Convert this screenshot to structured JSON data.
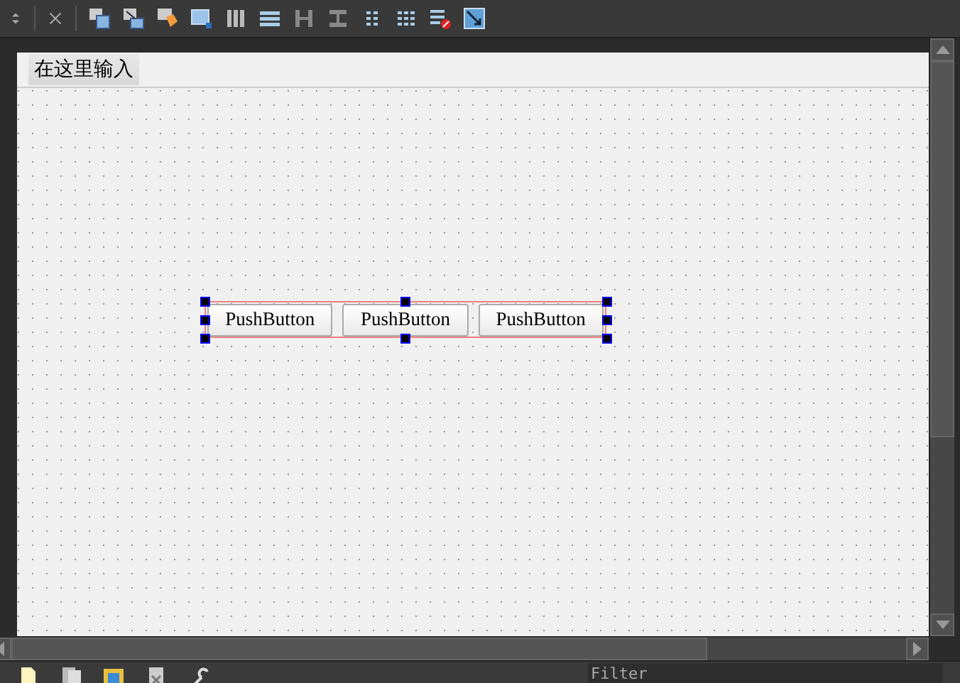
{
  "menu_bar": {
    "items": [
      {
        "label": "在这里输入",
        "selected": true
      }
    ]
  },
  "layout": {
    "selected": true,
    "buttons": [
      {
        "label": "PushButton"
      },
      {
        "label": "PushButton"
      },
      {
        "label": "PushButton"
      }
    ]
  },
  "filter": {
    "placeholder": "Filter"
  }
}
